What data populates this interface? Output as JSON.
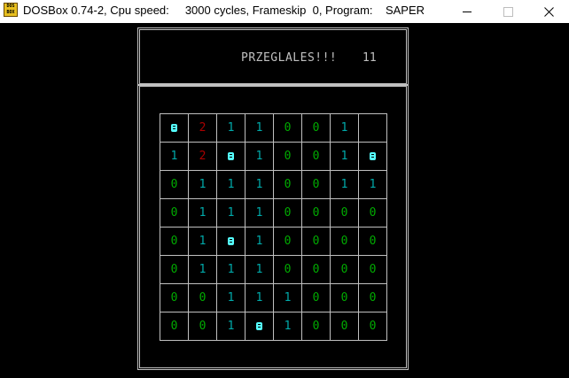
{
  "window": {
    "title": "DOSBox 0.74-2, Cpu speed:     3000 cycles, Frameskip  0, Program:    SAPER",
    "icon_text": [
      "DOS",
      "BOX"
    ]
  },
  "game": {
    "status_message": "PRZEGLALES!!!",
    "counter": "11",
    "board": [
      [
        "mine",
        "2",
        "1",
        "1",
        "0",
        "0",
        "1",
        ""
      ],
      [
        "1",
        "2",
        "mine",
        "1",
        "0",
        "0",
        "1",
        "mine"
      ],
      [
        "0",
        "1",
        "1",
        "1",
        "0",
        "0",
        "1",
        "1"
      ],
      [
        "0",
        "1",
        "1",
        "1",
        "0",
        "0",
        "0",
        "0"
      ],
      [
        "0",
        "1",
        "mine",
        "1",
        "0",
        "0",
        "0",
        "0"
      ],
      [
        "0",
        "1",
        "1",
        "1",
        "0",
        "0",
        "0",
        "0"
      ],
      [
        "0",
        "0",
        "1",
        "1",
        "1",
        "0",
        "0",
        "0"
      ],
      [
        "0",
        "0",
        "1",
        "mine",
        "1",
        "0",
        "0",
        "0"
      ]
    ]
  },
  "colors": {
    "zero": "#00aa00",
    "one": "#00aaaa",
    "two": "#aa0000",
    "mine": "#55ffff",
    "frame": "#c0c0c0"
  }
}
